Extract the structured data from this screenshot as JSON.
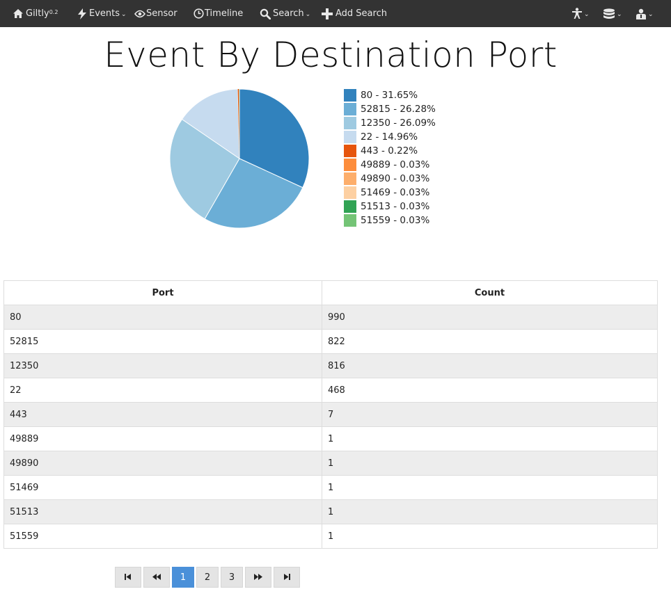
{
  "navbar": {
    "brand": "Giltly",
    "brand_version": "0.2",
    "events": "Events",
    "sensor": "Sensor",
    "timeline": "Timeline",
    "search": "Search",
    "add_search": "Add Search",
    "icons": [
      "home-icon",
      "bolt-icon",
      "eye-icon",
      "clock-icon",
      "search-icon",
      "plus-icon",
      "accessibility-icon",
      "database-icon",
      "user-icon"
    ]
  },
  "page_title": "Event By Destination Port",
  "chart_data": {
    "type": "pie",
    "title": "Event By Destination Port",
    "categories": [
      "80",
      "52815",
      "12350",
      "22",
      "443",
      "49889",
      "49890",
      "51469",
      "51513",
      "51559"
    ],
    "values": [
      990,
      822,
      816,
      468,
      7,
      1,
      1,
      1,
      1,
      1
    ],
    "legend_labels": [
      "80 - 31.65%",
      "52815 - 26.28%",
      "12350 - 26.09%",
      "22 - 14.96%",
      "443 - 0.22%",
      "49889 - 0.03%",
      "49890 - 0.03%",
      "51469 - 0.03%",
      "51513 - 0.03%",
      "51559 - 0.03%"
    ],
    "colors": [
      "#3182bd",
      "#6baed6",
      "#9ecae1",
      "#c6dbef",
      "#e6550d",
      "#fd8d3c",
      "#fdae6b",
      "#fdd0a2",
      "#31a354",
      "#74c476"
    ],
    "legend_position": "right"
  },
  "table": {
    "headers": [
      "Port",
      "Count"
    ],
    "rows": [
      [
        "80",
        "990"
      ],
      [
        "52815",
        "822"
      ],
      [
        "12350",
        "816"
      ],
      [
        "22",
        "468"
      ],
      [
        "443",
        "7"
      ],
      [
        "49889",
        "1"
      ],
      [
        "49890",
        "1"
      ],
      [
        "51469",
        "1"
      ],
      [
        "51513",
        "1"
      ],
      [
        "51559",
        "1"
      ]
    ]
  },
  "pagination": {
    "pages": [
      "1",
      "2",
      "3"
    ],
    "current": "1",
    "icons": [
      "first-page-icon",
      "previous-page-icon",
      "next-page-icon",
      "last-page-icon"
    ]
  }
}
